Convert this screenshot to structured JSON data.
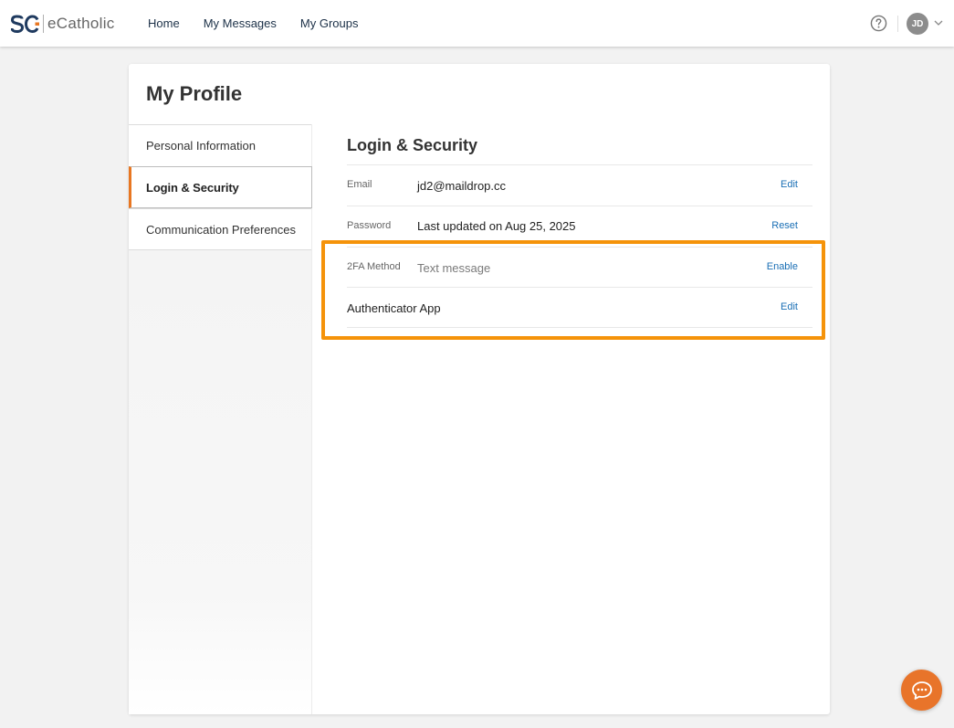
{
  "header": {
    "logo_text": "eCatholic",
    "nav": [
      "Home",
      "My Messages",
      "My Groups"
    ],
    "avatar_initials": "JD",
    "accent_color": "#e87722",
    "nav_color": "#1b3047"
  },
  "page": {
    "title": "My Profile"
  },
  "sidebar": {
    "items": [
      {
        "label": "Personal Information"
      },
      {
        "label": "Login & Security"
      },
      {
        "label": "Communication Preferences"
      }
    ],
    "active": "Login & Security"
  },
  "security": {
    "title": "Login & Security",
    "rows": [
      {
        "label": "Email",
        "value": "jd2@maildrop.cc",
        "action": "Edit"
      },
      {
        "label": "Password",
        "value": "Last updated on Aug 25, 2025",
        "action": "Reset"
      },
      {
        "label": "2FA Method",
        "value": "Text message",
        "action": "Enable"
      },
      {
        "label": "Authenticator App",
        "action": "Edit"
      }
    ],
    "link_color": "#1a6fb5",
    "highlight_color": "#f5930a"
  }
}
